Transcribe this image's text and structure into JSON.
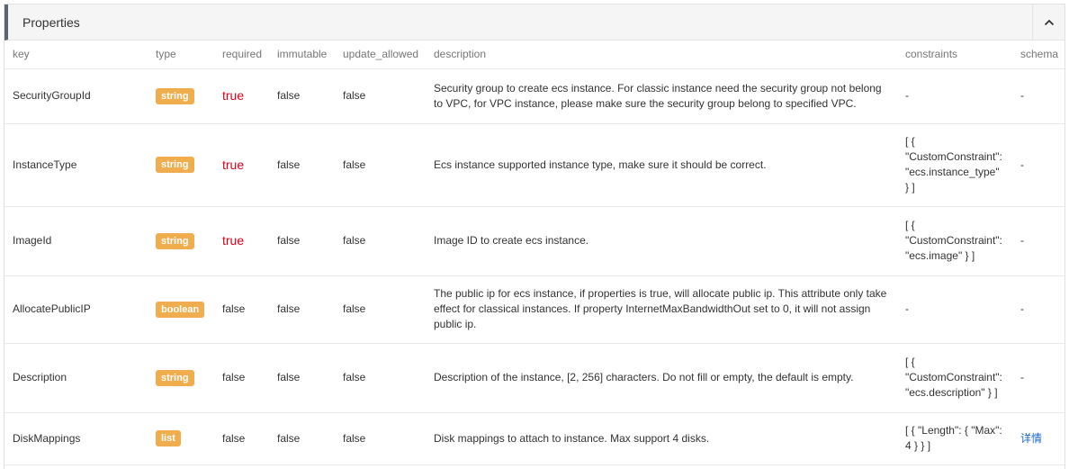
{
  "panel": {
    "title": "Properties"
  },
  "columns": {
    "key": "key",
    "type": "type",
    "required": "required",
    "immutable": "immutable",
    "update_allowed": "update_allowed",
    "description": "description",
    "constraints": "constraints",
    "schema": "schema"
  },
  "rows": [
    {
      "key": "SecurityGroupId",
      "type": "string",
      "required": "true",
      "immutable": "false",
      "update_allowed": "false",
      "description": "Security group to create ecs instance. For classic instance need the security group not belong to VPC, for VPC instance, please make sure the security group belong to specified VPC.",
      "constraints": "-",
      "schema": "-"
    },
    {
      "key": "InstanceType",
      "type": "string",
      "required": "true",
      "immutable": "false",
      "update_allowed": "false",
      "description": "Ecs instance supported instance type, make sure it should be correct.",
      "constraints": "[ {\n\"CustomConstraint\":\n\"ecs.instance_type\"\n} ]",
      "schema": "-"
    },
    {
      "key": "ImageId",
      "type": "string",
      "required": "true",
      "immutable": "false",
      "update_allowed": "false",
      "description": "Image ID to create ecs instance.",
      "constraints": "[ {\n\"CustomConstraint\":\n\"ecs.image\" } ]",
      "schema": "-"
    },
    {
      "key": "AllocatePublicIP",
      "type": "boolean",
      "required": "false",
      "immutable": "false",
      "update_allowed": "false",
      "description": "The public ip for ecs instance, if properties is true, will allocate public ip. This attribute only take effect for classical instances. If property InternetMaxBandwidthOut set to 0, it will not assign public ip.",
      "constraints": "-",
      "schema": "-"
    },
    {
      "key": "Description",
      "type": "string",
      "required": "false",
      "immutable": "false",
      "update_allowed": "false",
      "description": "Description of the instance, [2, 256] characters. Do not fill or empty, the default is empty.",
      "constraints": "[ {\n\"CustomConstraint\":\n\"ecs.description\" } ]",
      "schema": "-"
    },
    {
      "key": "DiskMappings",
      "type": "list",
      "required": "false",
      "immutable": "false",
      "update_allowed": "false",
      "description": "Disk mappings to attach to instance. Max support 4 disks.",
      "constraints": "[ { \"Length\": { \"Max\":\n4 } } ]",
      "schema": "详情"
    }
  ],
  "colors": {
    "badge": "#f0ad4e",
    "required_true": "#d9001b",
    "link": "#1a66cc",
    "header_accent": "#5b6471"
  },
  "icons": {
    "collapse": "chevron-up-icon"
  }
}
